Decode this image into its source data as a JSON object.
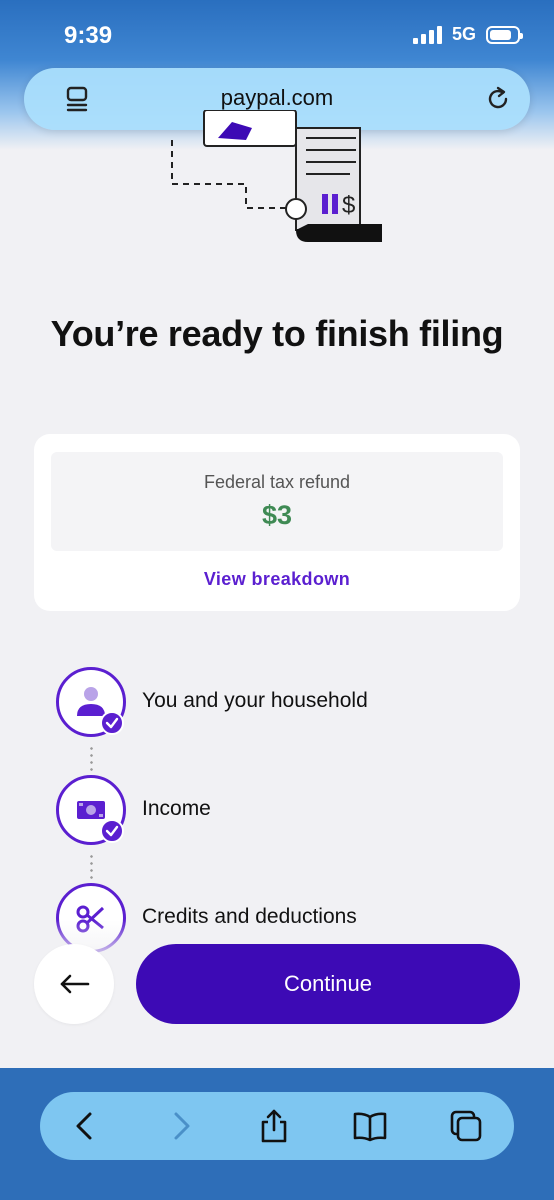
{
  "status": {
    "time": "9:39",
    "network": "5G",
    "battery_level": 0.8
  },
  "browser": {
    "url": "paypal.com",
    "menu_icon": "reader-menu-icon",
    "reload_icon": "reload-icon"
  },
  "page": {
    "title": "You’re ready to finish filing"
  },
  "refund": {
    "label": "Federal tax refund",
    "amount": "$3",
    "link": "View breakdown",
    "amount_color": "#3f8a54"
  },
  "steps": [
    {
      "label": "You and your household",
      "icon": "person-icon",
      "completed": true
    },
    {
      "label": "Income",
      "icon": "cash-icon",
      "completed": true
    },
    {
      "label": "Credits and deductions",
      "icon": "scissors-icon",
      "completed": false
    }
  ],
  "actions": {
    "back_icon": "arrow-left-icon",
    "continue_label": "Continue"
  },
  "colors": {
    "accent": "#5b1fd0",
    "primary_button": "#3d0ab5"
  },
  "toolbar": {
    "items": [
      "back-icon",
      "forward-icon",
      "share-icon",
      "bookmarks-icon",
      "tabs-icon"
    ]
  }
}
